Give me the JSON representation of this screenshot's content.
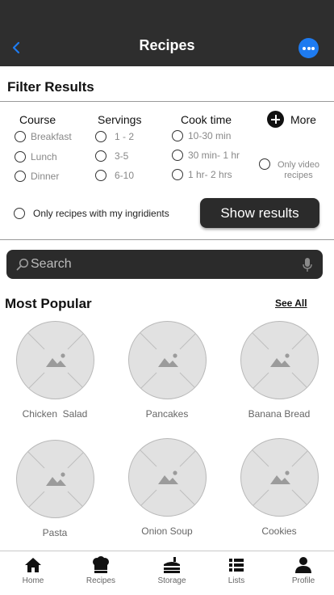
{
  "header": {
    "title": "Recipes"
  },
  "filter": {
    "title": "Filter Results",
    "course": {
      "heading": "Course",
      "options": [
        "Breakfast",
        "Lunch",
        "Dinner"
      ]
    },
    "servings": {
      "heading": "Servings",
      "options": [
        "1 - 2",
        "3-5",
        "6-10"
      ]
    },
    "cook_time": {
      "heading": "Cook time",
      "options": [
        "10-30 min",
        "30 min- 1 hr",
        "1 hr- 2 hrs"
      ]
    },
    "more_label": "More",
    "video_option": "Only video recipes",
    "ingredients_option": "Only recipes  with my ingridients",
    "show_results": "Show results"
  },
  "search": {
    "placeholder": "Search"
  },
  "popular": {
    "title": "Most Popular",
    "see_all": "See All",
    "items": [
      "Chicken  Salad",
      "Pancakes",
      "Banana Bread",
      "Pasta",
      "Onion Soup",
      "Cookies"
    ]
  },
  "tabs": [
    {
      "label": "Home",
      "icon": "home-icon"
    },
    {
      "label": "Recipes",
      "icon": "chef-hat-icon"
    },
    {
      "label": "Storage",
      "icon": "storage-icon"
    },
    {
      "label": "Lists",
      "icon": "list-icon"
    },
    {
      "label": "Profile",
      "icon": "profile-icon"
    }
  ],
  "colors": {
    "header_bg": "#2e2e2e",
    "accent": "#1e7bf0",
    "button_bg": "#2b2b2b"
  }
}
